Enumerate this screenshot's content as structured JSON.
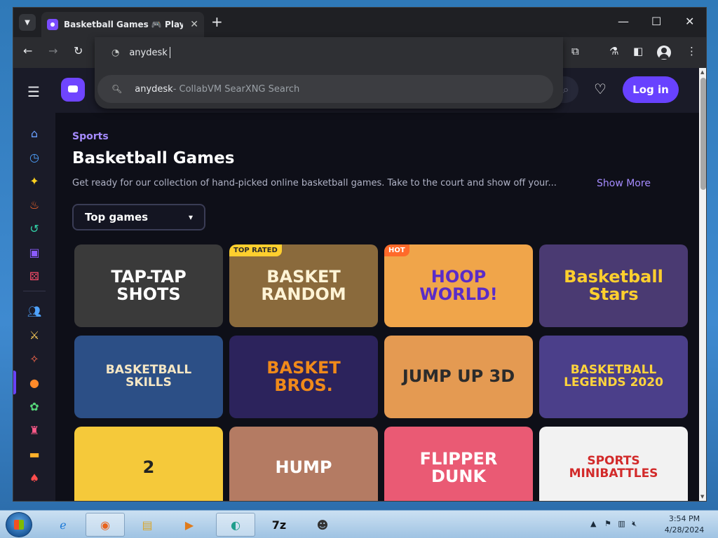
{
  "browser": {
    "tab_title": "Basketball Games 🎮 Play on CrazyGames",
    "tab_close": "✕",
    "new_tab": "+",
    "window_controls": {
      "minimize": "—",
      "maximize": "☐",
      "close": "✕"
    }
  },
  "omnibox": {
    "typed_text": "anydesk",
    "suggestion_query": "anydesk",
    "suggestion_engine": " - CollabVM SearXNG Search"
  },
  "site": {
    "login_label": "Log in",
    "breadcrumb": "Sports",
    "page_title": "Basketball Games",
    "description": "Get ready for our collection of hand-picked online basketball games. Take to the court and show off your...",
    "show_more": "Show More",
    "sort_selected": "Top games"
  },
  "games": [
    {
      "title": "TAP-TAP SHOTS",
      "badge": "",
      "bg": "#3a3a3a",
      "fg": "#ffffff"
    },
    {
      "title": "BASKET RANDOM",
      "badge": "TOP RATED",
      "bg": "#8a6a3c",
      "fg": "#fff4d6"
    },
    {
      "title": "HOOP WORLD!",
      "badge": "HOT",
      "bg": "#f0a54a",
      "fg": "#5a2cc8"
    },
    {
      "title": "Basketball Stars",
      "badge": "",
      "bg": "#4a3a72",
      "fg": "#ffcf2e"
    },
    {
      "title": "BASKETBALL SKILLS",
      "badge": "",
      "bg": "#2c4f86",
      "fg": "#f6e7c4"
    },
    {
      "title": "BASKET BROS.",
      "badge": "",
      "bg": "#2c235c",
      "fg": "#f08a1a"
    },
    {
      "title": "JUMP UP 3D",
      "badge": "",
      "bg": "#e49a52",
      "fg": "#2b2b2b"
    },
    {
      "title": "BASKETBALL LEGENDS 2020",
      "badge": "",
      "bg": "#4b3f8a",
      "fg": "#ffd43c"
    },
    {
      "title": "2",
      "badge": "",
      "bg": "#f5c93a",
      "fg": "#222222"
    },
    {
      "title": "HUMP",
      "badge": "",
      "bg": "#b47b63",
      "fg": "#ffffff"
    },
    {
      "title": "FLIPPER DUNK",
      "badge": "",
      "bg": "#ea5a74",
      "fg": "#ffffff"
    },
    {
      "title": "SPORTS MINIBATTLES",
      "badge": "",
      "bg": "#f2f2f2",
      "fg": "#d22a2a"
    }
  ],
  "taskbar": {
    "time": "3:54 PM",
    "date": "4/28/2024"
  },
  "colors": {
    "accent": "#6842ff",
    "page_bg": "#0e0f18",
    "header_bg": "#1a1b28"
  }
}
